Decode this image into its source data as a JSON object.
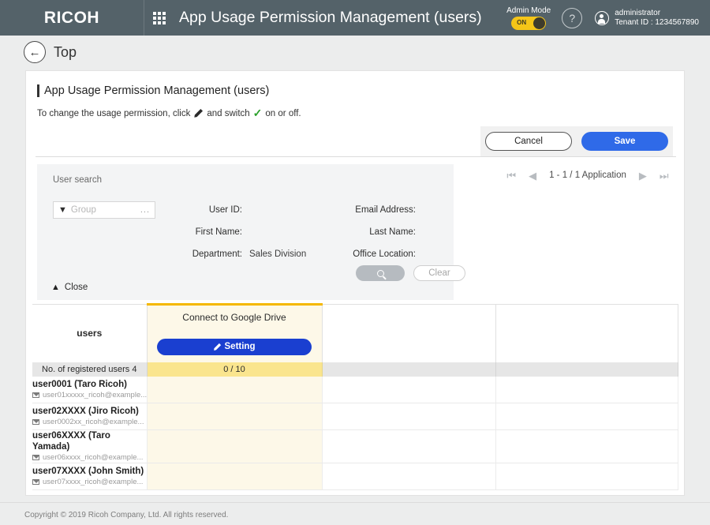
{
  "topbar": {
    "brand": "RICOH",
    "grid_icon": "apps-grid-icon",
    "app_title": "App Usage Permission Management (users)",
    "admin_mode_label": "Admin Mode",
    "admin_toggle_state": "ON",
    "help_icon": "question-mark-icon",
    "user_name": "administrator",
    "tenant_id": "Tenant ID : 1234567890",
    "colors": {
      "bar": "#546269",
      "toggle_on": "#f5c518"
    }
  },
  "breadcrumb": {
    "back_icon": "back-arrow-icon",
    "label": "Top"
  },
  "page": {
    "title": "App Usage Permission Management (users)",
    "instruction_prefix": "To change the usage permission, click",
    "instruction_middle": "and switch",
    "instruction_suffix": "on or off.",
    "pencil_icon": "pencil-icon",
    "check_icon": "green-check-icon"
  },
  "actions": {
    "cancel_label": "Cancel",
    "save_label": "Save",
    "save_color": "#2f6ae8"
  },
  "search": {
    "heading": "User search",
    "group_placeholder": "Group",
    "group_value": "",
    "group_ellipsis": "...",
    "funnel_icon": "filter-funnel-icon",
    "rows": [
      {
        "label_a": "User ID:",
        "value_a": "",
        "label_b": "Email Address:",
        "value_b": ""
      },
      {
        "label_a": "First Name:",
        "value_a": "",
        "label_b": "Last Name:",
        "value_b": ""
      },
      {
        "label_a": "Department:",
        "value_a": "Sales Division",
        "label_b": "Office Location:",
        "value_b": ""
      }
    ],
    "close_label": "Close",
    "close_icon": "chevron-up-icon",
    "search_icon": "magnifier-icon",
    "clear_label": "Clear"
  },
  "pager": {
    "first_icon": "⏮",
    "prev_icon": "◀",
    "text": "1 - 1 / 1 Application",
    "next_icon": "▶",
    "last_icon": "⏭"
  },
  "table": {
    "col_users_header": "users",
    "app_column": {
      "name": "Connect to Google Drive",
      "setting_label": "Setting",
      "setting_icon": "pencil-icon",
      "accent_color": "#f5b800",
      "body_color": "#fdf8e8"
    },
    "count_row": {
      "users_label": "No. of registered users 4",
      "app_value": "0 / 10"
    },
    "rows": [
      {
        "name": "user0001 (Taro Ricoh)",
        "email": "user01xxxxx_ricoh@example...",
        "mail_icon": "envelope-icon"
      },
      {
        "name": "user02XXXX (Jiro Ricoh)",
        "email": "user0002xx_ricoh@example...",
        "mail_icon": "envelope-icon"
      },
      {
        "name": "user06XXXX (Taro Yamada)",
        "email": "user06xxxx_ricoh@example...",
        "mail_icon": "envelope-icon"
      },
      {
        "name": "user07XXXX (John Smith)",
        "email": "user07xxxx_ricoh@example...",
        "mail_icon": "envelope-icon"
      }
    ]
  },
  "footer": {
    "copyright": "Copyright © 2019 Ricoh Company, Ltd. All rights reserved."
  }
}
